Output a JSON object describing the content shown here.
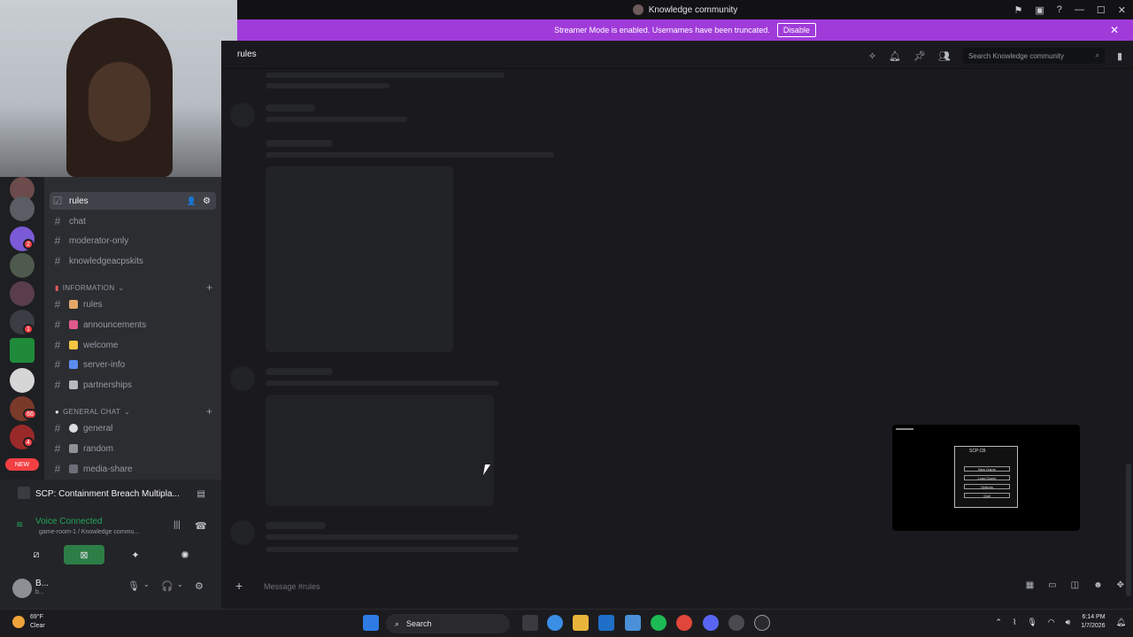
{
  "window": {
    "title": "Knowledge community"
  },
  "banner": {
    "text": "Streamer Mode is enabled. Usernames have been truncated.",
    "button": "Disable"
  },
  "header": {
    "channel": "rules",
    "search_placeholder": "Search Knowledge community"
  },
  "sidebar": {
    "top_channels": [
      {
        "label": "rules",
        "selected": true
      },
      {
        "label": "chat"
      },
      {
        "label": "moderator-only"
      },
      {
        "label": "knowledgeacpskits"
      }
    ],
    "categories": [
      {
        "name": "INFORMATION",
        "channels": [
          {
            "label": "rules",
            "emoji_color": "#e3a869"
          },
          {
            "label": "announcements",
            "emoji_color": "#e05a8a"
          },
          {
            "label": "welcome",
            "emoji_color": "#f5c542"
          },
          {
            "label": "server-info",
            "emoji_color": "#5b8cf2"
          },
          {
            "label": "partnerships",
            "emoji_color": "#b5bac1"
          }
        ]
      },
      {
        "name": "GENERAL CHAT",
        "channels": [
          {
            "label": "general",
            "emoji_color": "#dbdee1"
          },
          {
            "label": "random",
            "emoji_color": "#8e9297"
          },
          {
            "label": "media-share",
            "emoji_color": "#6d6f78"
          }
        ]
      }
    ]
  },
  "guild_badges": [
    {
      "count": "2"
    },
    {
      "count": "1"
    },
    {
      "count": "66"
    },
    {
      "count": "4"
    }
  ],
  "new_badge": "NEW",
  "activity": {
    "title": "SCP: Containment Breach Multipla..."
  },
  "voice": {
    "status": "Voice Connected",
    "channel": "game-room-1 / Knowledge commu..."
  },
  "user": {
    "name": "B...",
    "status": "b..."
  },
  "composer": {
    "placeholder": "Message #rules"
  },
  "taskbar": {
    "weather_temp": "69°F",
    "weather_desc": "Clear",
    "search": "Search",
    "time": "6:14 PM",
    "date": "1/7/2026"
  },
  "pip": {
    "title": "SCP:CB",
    "menu": [
      "New Game",
      "Load Game",
      "Options",
      "Quit"
    ]
  },
  "colors": {
    "accent": "#a03bd9",
    "online": "#23a55a",
    "danger": "#f23f43"
  }
}
